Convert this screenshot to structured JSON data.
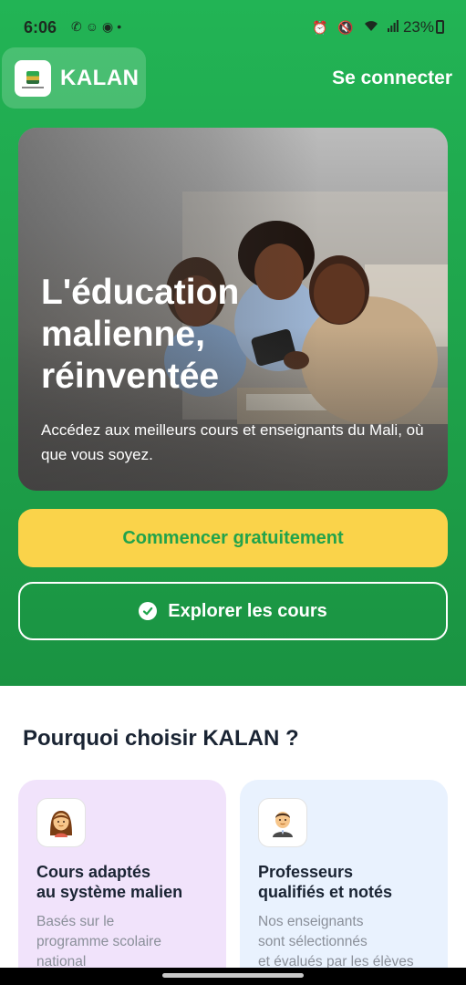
{
  "status_bar": {
    "time": "6:06",
    "battery": "23%",
    "left_icons": [
      "whatsapp-icon",
      "snapchat-icon",
      "spotify-icon",
      "dot-icon"
    ],
    "right_icons": [
      "alarm-icon",
      "mute-icon",
      "wifi-icon",
      "signal-icon",
      "battery-icon"
    ]
  },
  "header": {
    "brand": "KALAN",
    "signin_label": "Se connecter"
  },
  "hero": {
    "title": "L'éducation\nmalienne,\nréinventée",
    "subtitle": "Accédez aux meilleurs cours et enseignants du Mali, où que vous soyez."
  },
  "actions": {
    "primary_label": "Commencer gratuitement",
    "secondary_label": "Explorer les cours"
  },
  "why": {
    "title": "Pourquoi choisir KALAN ?",
    "features": [
      {
        "icon": "woman-emoji-icon",
        "title": "Cours adaptés\nau système malien",
        "description": "Basés sur le\nprogramme scolaire\nnational"
      },
      {
        "icon": "teacher-emoji-icon",
        "title": "Professeurs\nqualifiés et notés",
        "description": "Nos enseignants\nsont sélectionnés\net évalués par les élèves"
      }
    ]
  },
  "colors": {
    "green": "#22b455",
    "yellow": "#fad34a",
    "lavender": "#f1e3fb",
    "light_blue": "#e9f2fe"
  }
}
